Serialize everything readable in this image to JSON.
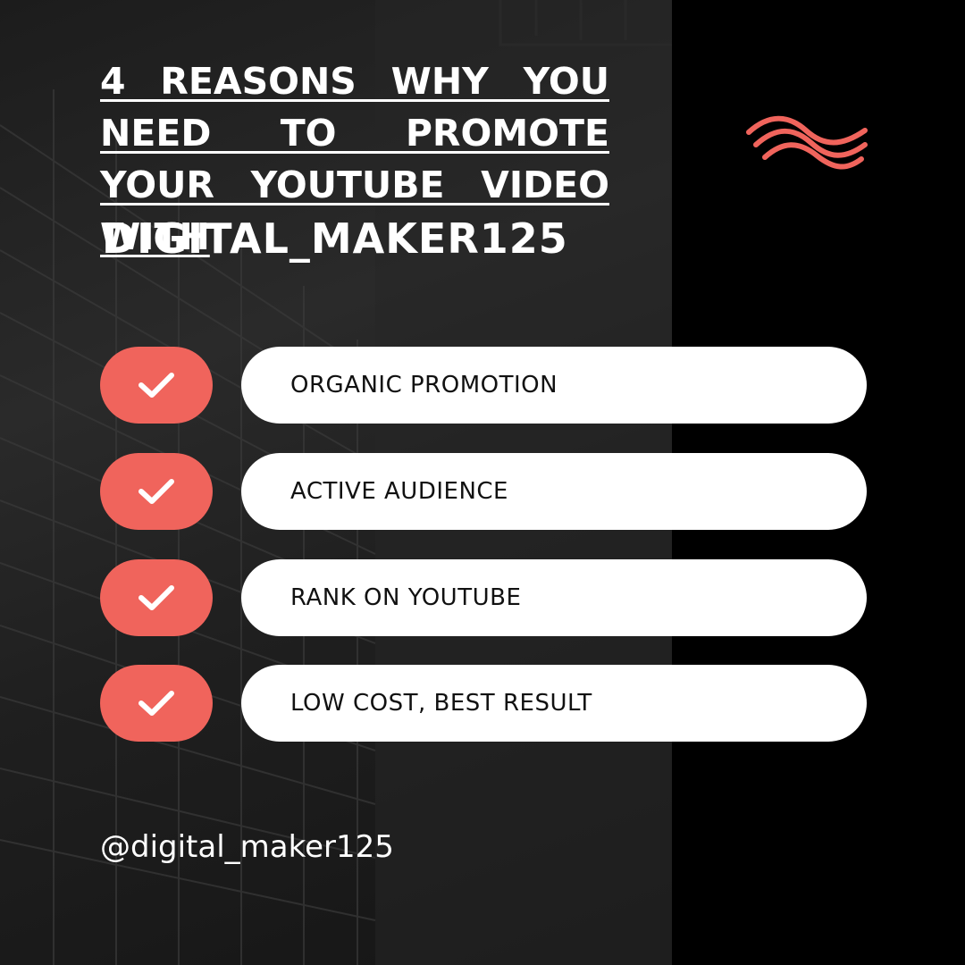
{
  "header": {
    "headline": "4 REASONS WHY YOU NEED TO PROMOTE YOUR YOUTUBE VIDEO WITH",
    "brand": "DIGITAL_MAKER125"
  },
  "reasons": [
    {
      "label": "ORGANIC PROMOTION",
      "icon": "check-icon"
    },
    {
      "label": "ACTIVE AUDIENCE",
      "icon": "check-icon"
    },
    {
      "label": "RANK ON YOUTUBE",
      "icon": "check-icon"
    },
    {
      "label": "LOW COST, BEST RESULT",
      "icon": "check-icon"
    }
  ],
  "footer": {
    "handle": "@digital_maker125"
  },
  "colors": {
    "accent": "#f0645c",
    "background": "#000000",
    "text": "#ffffff",
    "pill": "#ffffff"
  },
  "logo": {
    "icon": "waves-logo-icon"
  }
}
